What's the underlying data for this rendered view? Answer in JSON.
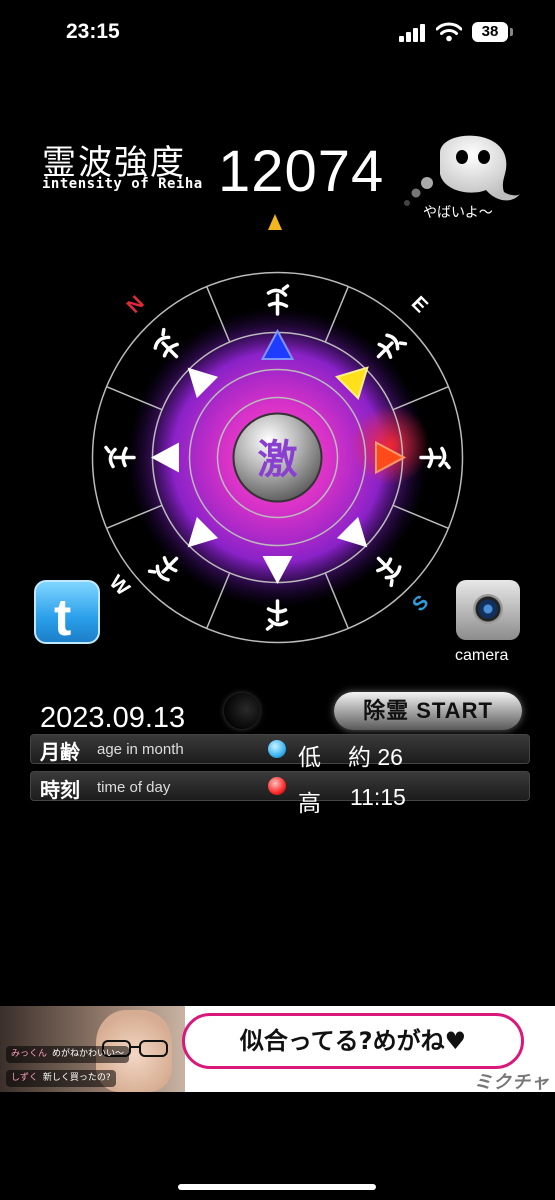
{
  "status_bar": {
    "time": "23:15",
    "battery": "38"
  },
  "header": {
    "title_jp": "霊波強度",
    "title_en": "intensity of Reiha",
    "reading": "12074",
    "ghost_message": "やばいよ〜"
  },
  "wheel": {
    "center_glyph": "激",
    "compass": {
      "n": "N",
      "e": "E",
      "s": "S",
      "w": "W"
    }
  },
  "buttons": {
    "camera_label": "camera",
    "exorcise": "除霊 START"
  },
  "info": {
    "date": "2023.09.13",
    "row1": {
      "label": "月齢",
      "sub": "age in month",
      "level": "低",
      "value": "約 26"
    },
    "row2": {
      "label": "時刻",
      "sub": "time of day",
      "level": "高",
      "value": "11:15"
    }
  },
  "ad": {
    "comment1": {
      "name": "みっくん",
      "text": "めがねかわいい〜"
    },
    "comment2": {
      "name": "しずく",
      "text": "新しく買ったの?"
    },
    "bubble": "似合ってる?めがね♥",
    "brand": "ミクチャ"
  },
  "colors": {
    "glow_core": "#ff3cb4",
    "glow_outer": "#7a1fc8",
    "triangle_blue": "#1e3cff",
    "triangle_yellow": "#ffe01a",
    "triangle_red": "#ff4a1a",
    "compass_n": "#e02a3c",
    "compass_s": "#2f9bd8",
    "ad_accent": "#d8197b"
  }
}
